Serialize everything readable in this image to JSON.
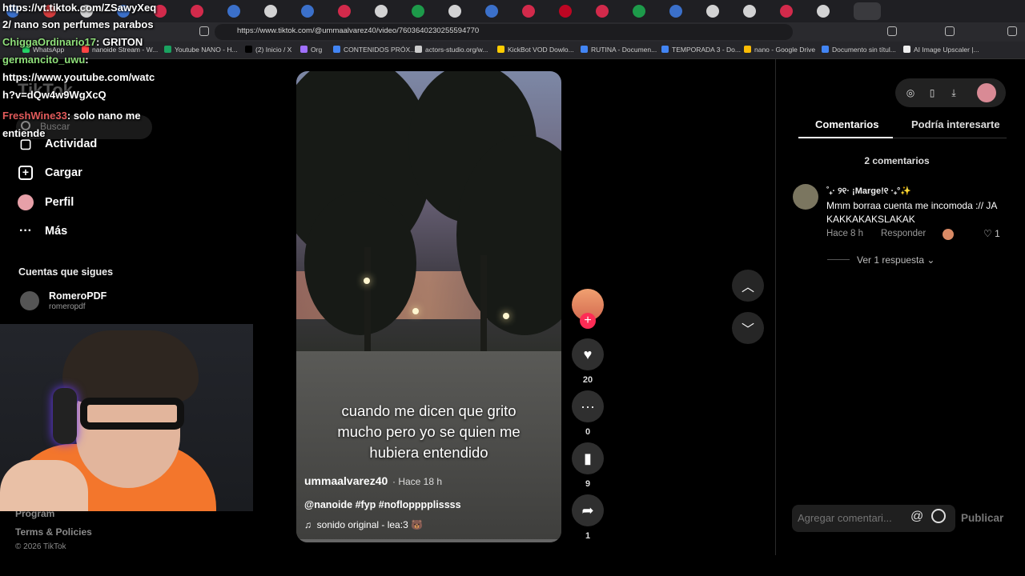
{
  "browser": {
    "url": "https://www.tiktok.com/@ummaalvarez40/video/7603640230255594770",
    "bookmarks": [
      "WhatsApp",
      "nanoide Stream - W...",
      "Youtube NANO - H...",
      "(2) Inicio / X",
      "Org",
      "CONTENIDOS PRÓX...",
      "actors-studio.org/w...",
      "KickBot VOD Dowlo...",
      "RUTINA - Documen...",
      "TEMPORADA 3 - Do...",
      "nano - Google Drive",
      "Documento sin títul...",
      "AI Image Upscaler |..."
    ]
  },
  "chat": [
    {
      "user": "",
      "text": "https://vt.tiktok.com/ZSawyXeq"
    },
    {
      "user": "",
      "text": "2/ nano son perfumes parabos"
    },
    {
      "user": "ChiggaOrdinario17",
      "text": " GRITON"
    },
    {
      "user": "germancito_uwu",
      "text": ""
    },
    {
      "user": "",
      "text": "https://www.youtube.com/watc"
    },
    {
      "user": "",
      "text": "h?v=dQw4w9WgXcQ"
    },
    {
      "user": "FreshWine33",
      "text": " solo nano me"
    },
    {
      "user": "",
      "text": "entiende"
    }
  ],
  "sidebar": {
    "logo": "TikTok",
    "search_placeholder": "Buscar",
    "items": [
      {
        "label": "Actividad"
      },
      {
        "label": "Cargar"
      },
      {
        "label": "Perfil"
      },
      {
        "label": "Más"
      }
    ],
    "following_title": "Cuentas que sigues",
    "following": [
      {
        "name": "RomeroPDF",
        "handle": "romeropdf"
      }
    ],
    "footer": [
      "Program",
      "Terms & Policies"
    ],
    "copyright": "© 2026 TikTok"
  },
  "video": {
    "caption_lines": [
      "cuando me dicen que grito",
      "mucho pero yo se quien me",
      "hubiera entendido"
    ],
    "author": "ummaalvarez40",
    "time": "· Hace 18 h",
    "tags": "@nanoide #fyp #noflopppplissss",
    "sound": "sonido original - lea:3 🐻"
  },
  "actions": {
    "likes": "20",
    "comments": "0",
    "saves": "9",
    "shares": "1"
  },
  "comments_panel": {
    "tab_comments": "Comentarios",
    "tab_other": "Podría interesarte",
    "count": "2 comentarios",
    "comments": [
      {
        "user": "˚₊· ୨୧· ¡Marge!୧ ·₊°✨",
        "text": "Mmm borraa cuenta me incomoda :// JA KAKKAKAKSLAKAK",
        "time": "Hace 8 h",
        "reply": "Responder",
        "likes": "1",
        "view_replies": "Ver 1 respuesta"
      }
    ],
    "input_placeholder": "Agregar comentari...",
    "publish": "Publicar"
  }
}
